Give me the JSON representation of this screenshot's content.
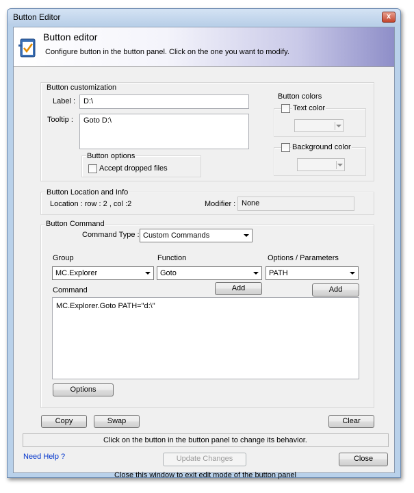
{
  "window": {
    "title": "Button Editor",
    "close_glyph": "x"
  },
  "header": {
    "title": "Button editor",
    "subtitle": "Configure button in the button panel. Click on the one you want to modify.",
    "icon": "checklist-icon"
  },
  "customization": {
    "group_label": "Button customization",
    "label_caption": "Label :",
    "label_value": "D:\\",
    "tooltip_caption": "Tooltip :",
    "tooltip_value": "Goto D:\\",
    "options_label": "Button options",
    "accept_dropped_files": "Accept dropped files",
    "accept_dropped_files_checked": false
  },
  "colors": {
    "group_label": "Button colors",
    "text_color_label": "Text color",
    "text_color_checked": false,
    "background_color_label": "Background color",
    "background_color_checked": false
  },
  "location": {
    "group_label": "Button Location and Info",
    "location_text": "Location : row : 2 , col :2",
    "modifier_caption": "Modifier :",
    "modifier_value": "None"
  },
  "command": {
    "group_label": "Button Command",
    "type_caption": "Command Type :",
    "type_value": "Custom Commands",
    "group_caption": "Group",
    "group_value": "MC.Explorer",
    "function_caption": "Function",
    "function_value": "Goto",
    "params_caption": "Options / Parameters",
    "params_value": "PATH",
    "add_label": "Add",
    "add2_label": "Add",
    "command_caption": "Command",
    "command_text": "MC.Explorer.Goto PATH=\"d:\\\"",
    "options_button": "Options"
  },
  "actions": {
    "copy": "Copy",
    "swap": "Swap",
    "clear": "Clear"
  },
  "status": "Click on the button in the button panel to change its behavior.",
  "footer": {
    "help": "Need Help ?",
    "update": "Update Changes",
    "close": "Close",
    "hint": "Close this window to exit edit mode of the button panel"
  }
}
